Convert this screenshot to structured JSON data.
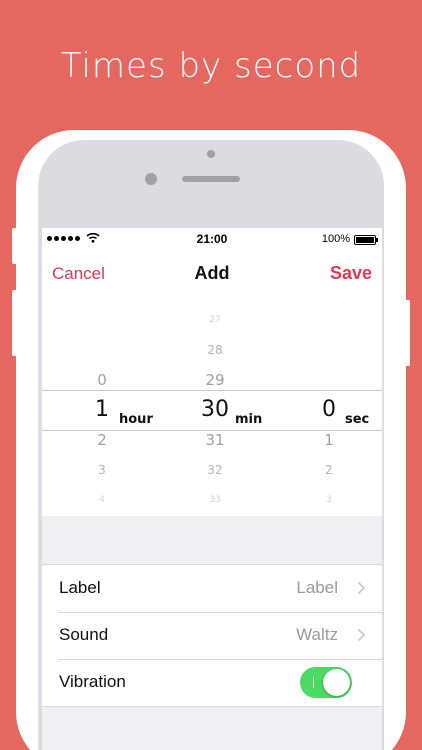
{
  "headline": "Times by second",
  "status_bar": {
    "time": "21:00",
    "battery": "100%"
  },
  "nav": {
    "cancel": "Cancel",
    "title": "Add",
    "save": "Save"
  },
  "picker": {
    "hours": {
      "above": [
        "0"
      ],
      "selected": "1",
      "below": [
        "2",
        "3",
        "4"
      ],
      "unit": "hour"
    },
    "minutes": {
      "above": [
        "27",
        "28",
        "29"
      ],
      "selected": "30",
      "below": [
        "31",
        "32",
        "33"
      ],
      "unit": "min"
    },
    "seconds": {
      "above": [],
      "selected": "0",
      "below": [
        "1",
        "2",
        "3"
      ],
      "unit": "sec"
    }
  },
  "settings": [
    {
      "label": "Label",
      "value": "Label",
      "type": "disclosure"
    },
    {
      "label": "Sound",
      "value": "Waltz",
      "type": "disclosure"
    },
    {
      "label": "Vibration",
      "value": "",
      "type": "toggle",
      "on": true
    }
  ],
  "colors": {
    "background": "#E4685F",
    "accent": "#E1394E",
    "toggle_on": "#4CD964"
  },
  "icons": [
    "signal-dots-icon",
    "wifi-icon",
    "battery-icon",
    "chevron-right-icon"
  ]
}
